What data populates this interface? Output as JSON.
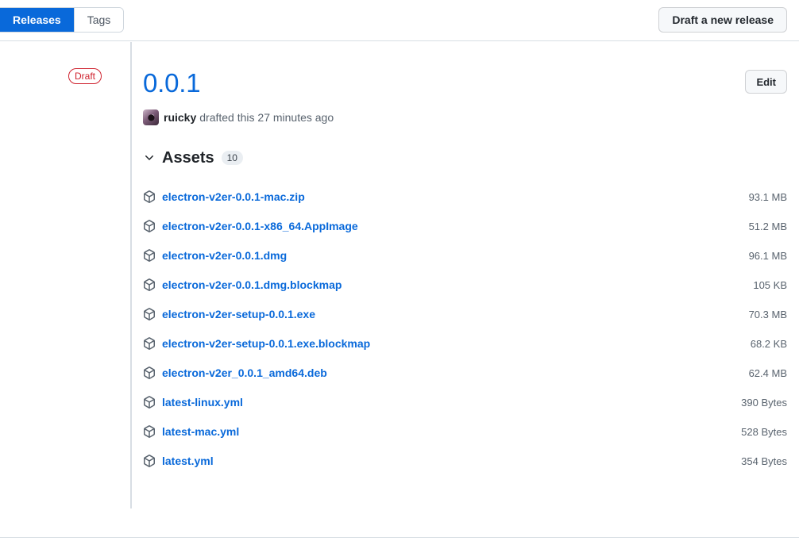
{
  "header": {
    "tabs": [
      {
        "label": "Releases",
        "active": true
      },
      {
        "label": "Tags",
        "active": false
      }
    ],
    "draft_new_release_label": "Draft a new release"
  },
  "release": {
    "status_badge": "Draft",
    "version": "0.0.1",
    "edit_label": "Edit",
    "byline": {
      "author": "ruicky",
      "action_text": "drafted this 27 minutes ago"
    }
  },
  "assets": {
    "title": "Assets",
    "count": "10",
    "expanded": true,
    "items": [
      {
        "name": "electron-v2er-0.0.1-mac.zip",
        "size": "93.1 MB"
      },
      {
        "name": "electron-v2er-0.0.1-x86_64.AppImage",
        "size": "51.2 MB"
      },
      {
        "name": "electron-v2er-0.0.1.dmg",
        "size": "96.1 MB"
      },
      {
        "name": "electron-v2er-0.0.1.dmg.blockmap",
        "size": "105 KB"
      },
      {
        "name": "electron-v2er-setup-0.0.1.exe",
        "size": "70.3 MB"
      },
      {
        "name": "electron-v2er-setup-0.0.1.exe.blockmap",
        "size": "68.2 KB"
      },
      {
        "name": "electron-v2er_0.0.1_amd64.deb",
        "size": "62.4 MB"
      },
      {
        "name": "latest-linux.yml",
        "size": "390 Bytes"
      },
      {
        "name": "latest-mac.yml",
        "size": "528 Bytes"
      },
      {
        "name": "latest.yml",
        "size": "354 Bytes"
      }
    ]
  },
  "colors": {
    "accent_blue": "#0969da",
    "draft_red": "#cf222e",
    "muted_text": "#59636e",
    "border": "#d8dee4"
  },
  "icons": {
    "chevron": "chevron-down-icon",
    "package": "package-icon"
  }
}
